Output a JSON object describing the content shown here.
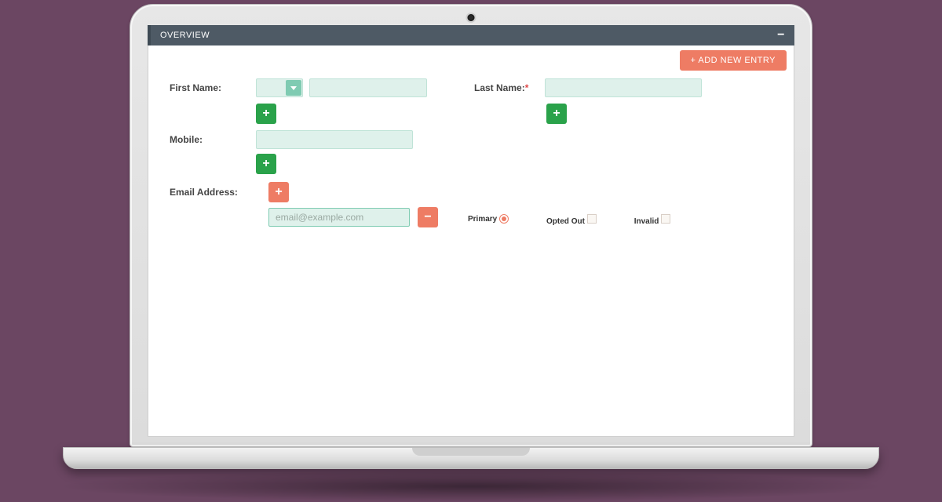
{
  "panel": {
    "title": "OVERVIEW"
  },
  "toolbar": {
    "add_entry_label": "+ ADD NEW ENTRY"
  },
  "labels": {
    "first_name": "First Name:",
    "last_name": "Last Name:",
    "last_name_required_mark": "*",
    "mobile": "Mobile:",
    "email": "Email Address:"
  },
  "fields": {
    "first_name_prefix": "",
    "first_name_value": "",
    "last_name_value": "",
    "mobile_value": ""
  },
  "email": {
    "placeholder": "email@example.com",
    "value": "",
    "primary_label": "Primary",
    "opted_out_label": "Opted Out",
    "invalid_label": "Invalid",
    "primary_checked": true,
    "opted_out_checked": false,
    "invalid_checked": false
  },
  "icons": {
    "plus": "+",
    "minus": "−"
  },
  "colors": {
    "page_bg": "#6b4662",
    "header_bg": "#4e5a65",
    "accent_coral": "#ee7c64",
    "accent_green": "#2aa24a",
    "input_bg": "#dff1eb"
  }
}
